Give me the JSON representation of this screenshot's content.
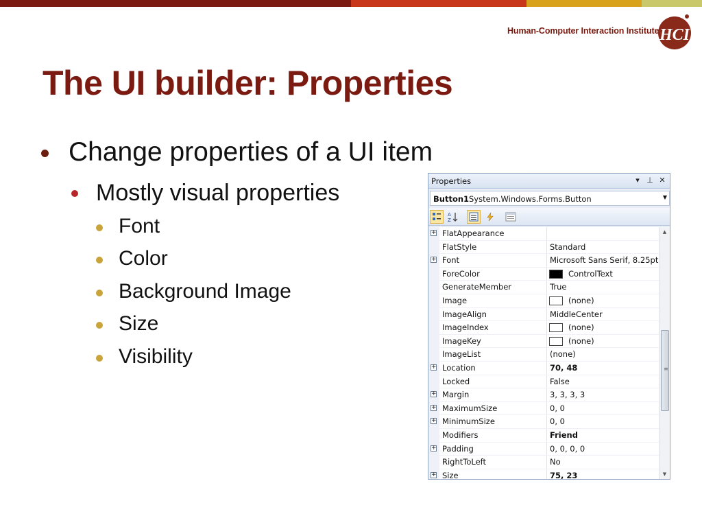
{
  "colors": {
    "band": [
      "#7a1a10",
      "#c8371a",
      "#d9a21c",
      "#c9c86a"
    ],
    "title": "#7a1a10"
  },
  "institute": {
    "name": "Human-Computer Interaction Institute",
    "logo_text": "HCI"
  },
  "slide": {
    "title": "The UI builder: Properties",
    "bullet1": "Change properties of a UI item",
    "bullet2": "Mostly visual properties",
    "sub_bullets": [
      "Font",
      "Color",
      "Background Image",
      "Size",
      "Visibility"
    ]
  },
  "properties_window": {
    "title": "Properties",
    "pin_glyph": "⊥",
    "dropdown_glyph": "▾",
    "close_glyph": "✕",
    "object_name": "Button1",
    "object_type": "System.Windows.Forms.Button",
    "toolbar_icons": [
      "categorized-icon",
      "alphabetical-icon",
      "properties-icon",
      "events-icon",
      "property-pages-icon"
    ],
    "rows": [
      {
        "name": "FlatAppearance",
        "value": "",
        "expandable": true,
        "bold": false,
        "swatch": ""
      },
      {
        "name": "FlatStyle",
        "value": "Standard",
        "expandable": false,
        "bold": false,
        "swatch": ""
      },
      {
        "name": "Font",
        "value": "Microsoft Sans Serif, 8.25pt",
        "expandable": true,
        "bold": false,
        "swatch": ""
      },
      {
        "name": "ForeColor",
        "value": "ControlText",
        "expandable": false,
        "bold": false,
        "swatch": "#000000"
      },
      {
        "name": "GenerateMember",
        "value": "True",
        "expandable": false,
        "bold": false,
        "swatch": ""
      },
      {
        "name": "Image",
        "value": "(none)",
        "expandable": false,
        "bold": false,
        "swatch": "#ffffff"
      },
      {
        "name": "ImageAlign",
        "value": "MiddleCenter",
        "expandable": false,
        "bold": false,
        "swatch": ""
      },
      {
        "name": "ImageIndex",
        "value": "(none)",
        "expandable": false,
        "bold": false,
        "swatch": "#ffffff"
      },
      {
        "name": "ImageKey",
        "value": "(none)",
        "expandable": false,
        "bold": false,
        "swatch": "#ffffff"
      },
      {
        "name": "ImageList",
        "value": "(none)",
        "expandable": false,
        "bold": false,
        "swatch": ""
      },
      {
        "name": "Location",
        "value": "70, 48",
        "expandable": true,
        "bold": true,
        "swatch": ""
      },
      {
        "name": "Locked",
        "value": "False",
        "expandable": false,
        "bold": false,
        "swatch": ""
      },
      {
        "name": "Margin",
        "value": "3, 3, 3, 3",
        "expandable": true,
        "bold": false,
        "swatch": ""
      },
      {
        "name": "MaximumSize",
        "value": "0, 0",
        "expandable": true,
        "bold": false,
        "swatch": ""
      },
      {
        "name": "MinimumSize",
        "value": "0, 0",
        "expandable": true,
        "bold": false,
        "swatch": ""
      },
      {
        "name": "Modifiers",
        "value": "Friend",
        "expandable": false,
        "bold": true,
        "swatch": ""
      },
      {
        "name": "Padding",
        "value": "0, 0, 0, 0",
        "expandable": true,
        "bold": false,
        "swatch": ""
      },
      {
        "name": "RightToLeft",
        "value": "No",
        "expandable": false,
        "bold": false,
        "swatch": ""
      },
      {
        "name": "Size",
        "value": "75, 23",
        "expandable": true,
        "bold": true,
        "swatch": ""
      }
    ]
  }
}
